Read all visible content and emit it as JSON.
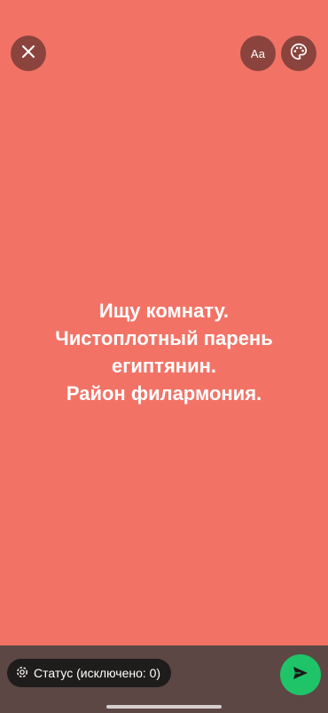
{
  "colors": {
    "background": "#f27366",
    "bottom_bar": "#5c4744",
    "send_button": "#1fc469"
  },
  "toolbar": {
    "close_icon": "close-icon",
    "font_button_label": "Aa",
    "palette_icon": "palette-icon"
  },
  "status": {
    "text": "Ищу комнату.\nЧистоплотный парень\nегиптянин.\nРайон филармония."
  },
  "footer": {
    "audience_label": "Статус (исключено: 0)",
    "audience_icon": "status-icon",
    "send_icon": "send-icon"
  }
}
